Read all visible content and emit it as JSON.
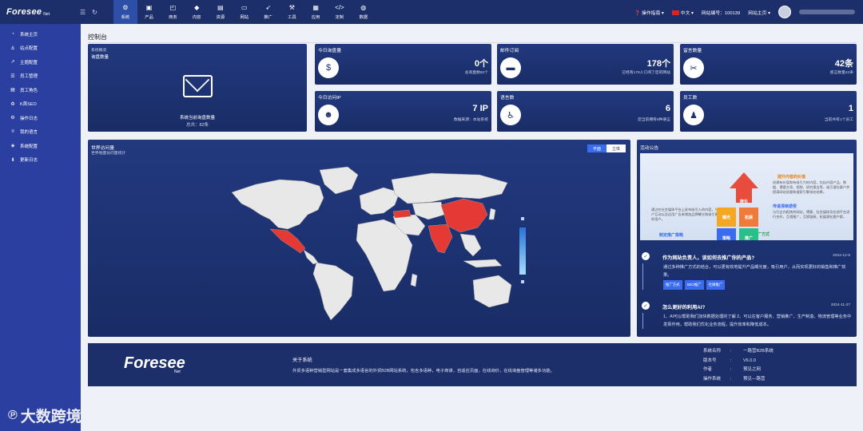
{
  "brand": {
    "logo_text": "Foresee",
    "logo_sub": "Net",
    "logo_cn": "预见之网"
  },
  "top_nav": [
    {
      "icon": "gear-icon",
      "label": "系统",
      "active": true
    },
    {
      "icon": "box-icon",
      "label": "产品"
    },
    {
      "icon": "bag-icon",
      "label": "商务"
    },
    {
      "icon": "cube-icon",
      "label": "内容"
    },
    {
      "icon": "database-icon",
      "label": "资源"
    },
    {
      "icon": "monitor-icon",
      "label": "网站"
    },
    {
      "icon": "rocket-icon",
      "label": "推广"
    },
    {
      "icon": "tools-icon",
      "label": "工具"
    },
    {
      "icon": "apps-icon",
      "label": "应用"
    },
    {
      "icon": "code-icon",
      "label": "定制"
    },
    {
      "icon": "globe-icon",
      "label": "数据"
    }
  ],
  "top_right": {
    "guide": "操作指南",
    "lang": "中文",
    "site_no": "网站编号：100139",
    "site_home": "网站主页"
  },
  "sidebar": [
    {
      "icon": "dashboard-icon",
      "label": "系统主页"
    },
    {
      "icon": "anchor-icon",
      "label": "站点配置"
    },
    {
      "icon": "chart-icon",
      "label": "主题配置"
    },
    {
      "icon": "users-icon",
      "label": "员工管理"
    },
    {
      "icon": "user-role-icon",
      "label": "员工角色"
    },
    {
      "icon": "seo-icon",
      "label": "K首SEO"
    },
    {
      "icon": "log-icon",
      "label": "操作日志"
    },
    {
      "icon": "language-icon",
      "label": "我的语言"
    },
    {
      "icon": "config-icon",
      "label": "系统配置"
    },
    {
      "icon": "update-icon",
      "label": "更新日志"
    }
  ],
  "watermark": "大数跨境",
  "page_title": "控制台",
  "mail_card": {
    "overview": "系统概况",
    "title": "询盘数量",
    "caption": "系统当前询盘数量",
    "total": "总共：82条"
  },
  "stats": [
    {
      "title": "今日询盘量",
      "icon": "money-hand-icon",
      "value": "0个",
      "sub": "总询盘数82个"
    },
    {
      "title": "邮件订阅",
      "icon": "bed-icon",
      "value": "178个",
      "sub": "已经有178人订阅了您的网站"
    },
    {
      "title": "留言数量",
      "icon": "wrench-icon",
      "value": "42条",
      "sub": "留言数量42条"
    },
    {
      "title": "今日访问IP",
      "icon": "ip-icon",
      "value": "7 IP",
      "sub": "数据来源：本站系统"
    },
    {
      "title": "语言数",
      "icon": "accessible-icon",
      "value": "6",
      "sub": "您当前拥有6种语言"
    },
    {
      "title": "员工数",
      "icon": "employee-icon",
      "value": "1",
      "sub": "当前共有1个员工"
    }
  ],
  "map_card": {
    "title": "世界访问量",
    "subtitle": "世界地图访问量统计",
    "tab_flat": "平面",
    "tab_3d": "立体"
  },
  "news": {
    "title": "活动公告",
    "banner": {
      "head": "提升内容的价值",
      "t1": "创建有价值和有吸引力的内容，包括内容产品、数据、博客文章、视频、研究报告等，吸引潜在客户并提高网站质量和搜索引擎排名结果。",
      "blue1": "传递清晰感受",
      "t2": "与行业内相关的网站、博客、社交媒体及在线平台进行合作，互相推广，互换链接，拓展潜在客户群。",
      "t3": "通过在社交媒体平台上发布吸引人的内容，与用户互动以及运用广告来增加品牌曝光和吸引更多的用户。",
      "blue2": "制定推广策略",
      "green": "多种推广方式",
      "b_top": "转化",
      "b_left": "曝光",
      "b_right": "拓展",
      "b_bl": "策略",
      "b_br": "推广"
    },
    "items": [
      {
        "title": "作为网站负责人，该如何去推广你的产品?",
        "date": "2024-12-5",
        "body": "通过多种推广方式的结合，可以更有效地提升产品曝光度，吸引用户，从而实现更好的销售和推广效果。",
        "tags": [
          "推广方式",
          "SEO推广",
          "社媒推广"
        ]
      },
      {
        "title": "怎么更好的利用AI?",
        "date": "2024-11-27",
        "body": "1、AI可以帮助我们加快数据处理的了解 2、可以在客户服务、营销推广、生产制造、物流管理等业务中发挥作用，帮助我们优化业务流程，提升效率和降低成本。",
        "tags": []
      }
    ]
  },
  "footer": {
    "about": "关于系统",
    "desc": "外贸多语种营销型网站是一套集成多语言的外贸B2B网站系统，包含多语种，电子商谋，自适应页面，在线询价，在线询盘管理等诸多功能。",
    "info": [
      {
        "k": "系统名称",
        "v": "一路营B2B系统"
      },
      {
        "k": "版本号",
        "v": "V6.0.0"
      },
      {
        "k": "作者",
        "v": "预见之网"
      },
      {
        "k": "操作系统",
        "v": "预见—路营"
      }
    ]
  },
  "colors": {
    "topbar": "#1d2f6b",
    "sidebar": "#2a3fa0",
    "card": "#1d2f6b",
    "highlight": "#e53935",
    "accent": "#3a6cf1"
  }
}
